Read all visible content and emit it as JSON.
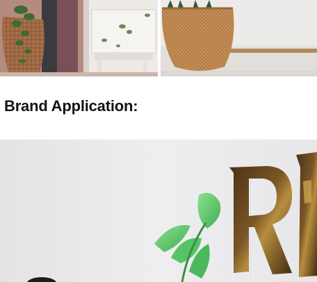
{
  "section": {
    "heading": "Brand Application:"
  },
  "images": {
    "left_photo": "woven-basket-plant-on-chair-photo",
    "right_photo": "seagrass-basket-plant-photo",
    "brand_photo": "metal-logo-letters-with-plant-photo"
  },
  "colors": {
    "heading_text": "#141414",
    "basket": "#c08a4c",
    "letters": "#5a3d1c",
    "plant_green": "#5fcf6f"
  }
}
